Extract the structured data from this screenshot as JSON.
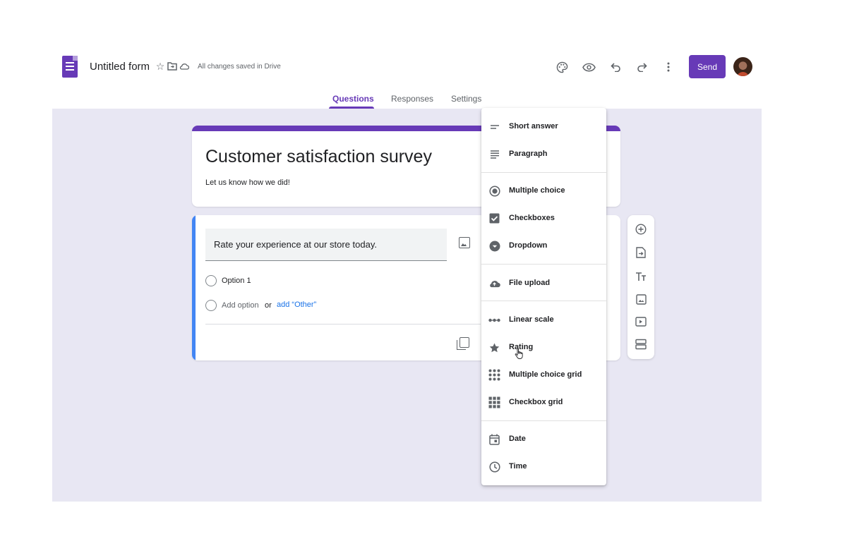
{
  "header": {
    "form_title": "Untitled form",
    "saved_status": "All changes saved in Drive",
    "send_label": "Send",
    "icons": [
      "star-icon",
      "move-to-folder-icon",
      "cloud-icon",
      "palette-icon",
      "preview-eye-icon",
      "undo-icon",
      "redo-icon",
      "more-vert-icon"
    ]
  },
  "tabs": [
    {
      "label": "Questions",
      "active": true
    },
    {
      "label": "Responses",
      "active": false
    },
    {
      "label": "Settings",
      "active": false
    }
  ],
  "form": {
    "title": "Customer satisfaction survey",
    "description": "Let us know how we did!",
    "question": {
      "text": "Rate your experience at our store today.",
      "option_1": "Option 1",
      "add_option": "Add option",
      "or": "or",
      "add_other": "add “Other”"
    }
  },
  "side_toolbar": {
    "icons": [
      "add-question-icon",
      "import-questions-icon",
      "add-title-icon",
      "add-image-icon",
      "add-video-icon",
      "add-section-icon"
    ]
  },
  "question_type_menu": {
    "items": [
      {
        "label": "Short answer",
        "icon": "short-answer-icon"
      },
      {
        "label": "Paragraph",
        "icon": "paragraph-icon"
      },
      {
        "label": "Multiple choice",
        "icon": "radio-icon"
      },
      {
        "label": "Checkboxes",
        "icon": "checkbox-icon"
      },
      {
        "label": "Dropdown",
        "icon": "dropdown-icon"
      },
      {
        "label": "File upload",
        "icon": "cloud-upload-icon"
      },
      {
        "label": "Linear scale",
        "icon": "linear-scale-icon"
      },
      {
        "label": "Rating",
        "icon": "star-icon"
      },
      {
        "label": "Multiple choice grid",
        "icon": "grid-dots-icon"
      },
      {
        "label": "Checkbox grid",
        "icon": "grid-squares-icon"
      },
      {
        "label": "Date",
        "icon": "calendar-icon"
      },
      {
        "label": "Time",
        "icon": "clock-icon"
      }
    ]
  },
  "colors": {
    "brand": "#673ab7",
    "canvas": "#e8e7f3",
    "active_question_bar": "#4285f4",
    "link": "#1a73e8"
  }
}
